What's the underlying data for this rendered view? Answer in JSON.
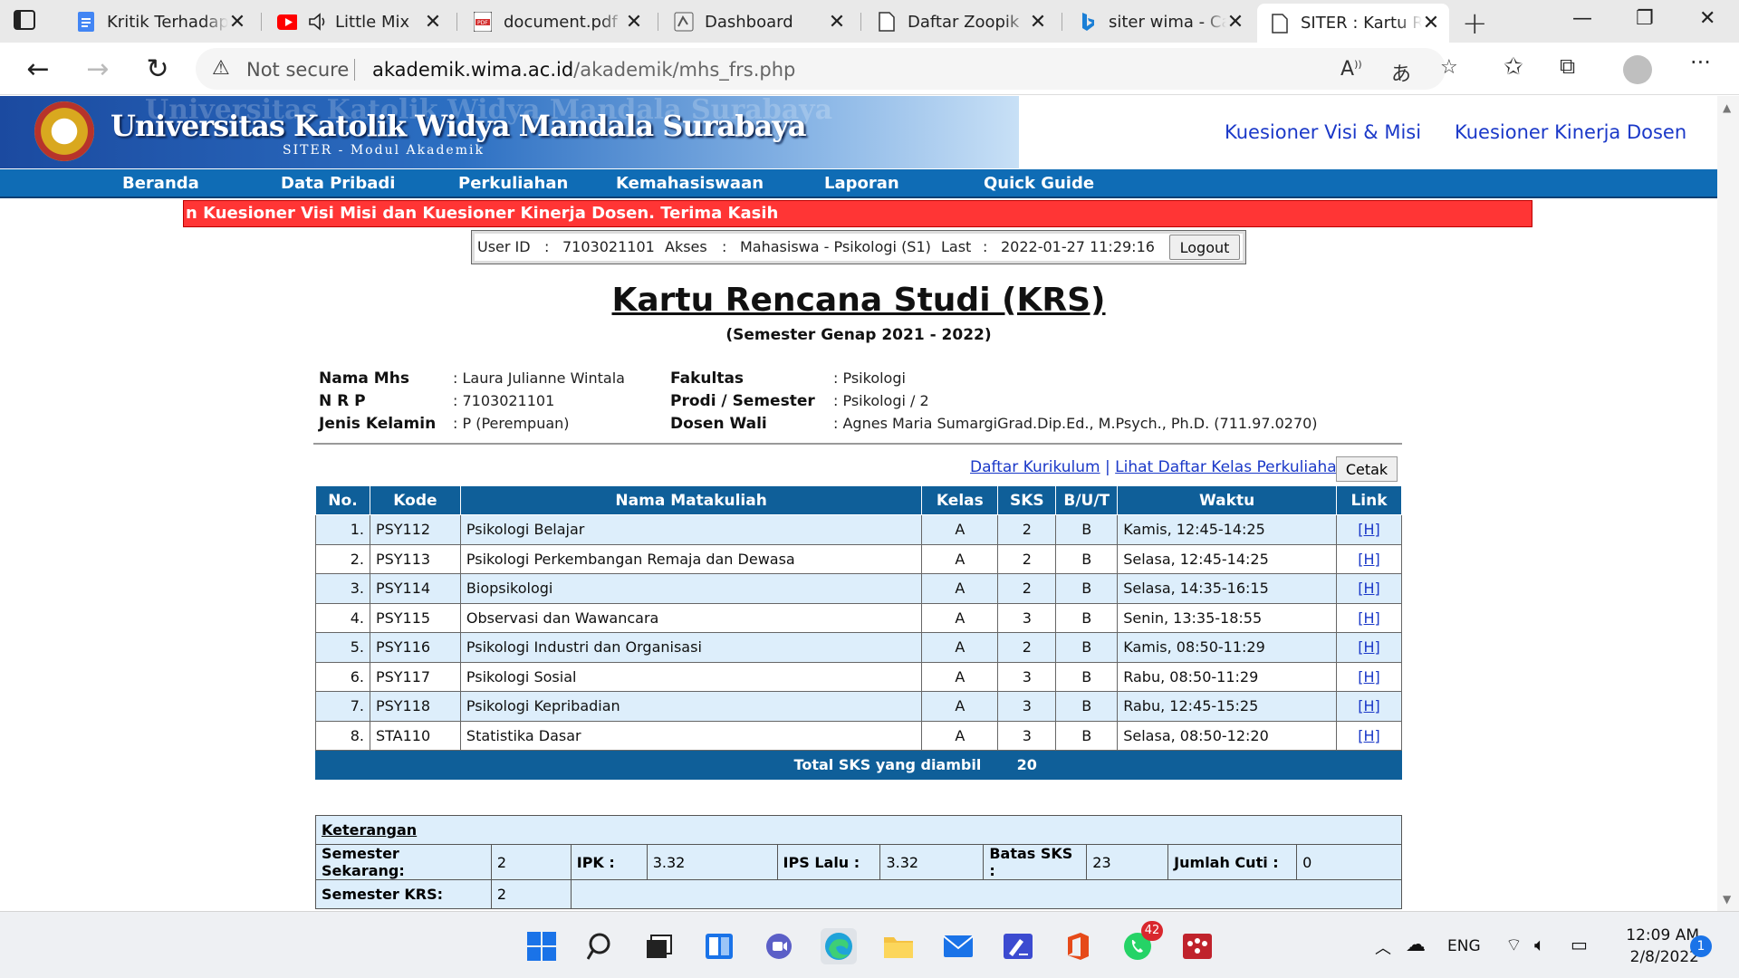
{
  "browser": {
    "tabs": [
      {
        "title": "Kritik Terhadap",
        "icon": "docs-icon"
      },
      {
        "title": "Little Mix",
        "icon": "youtube-icon"
      },
      {
        "title": "document.pdf",
        "icon": "pdf-icon"
      },
      {
        "title": "Dashboard",
        "icon": "dashboard-icon"
      },
      {
        "title": "Daftar Zoopik",
        "icon": "page-icon"
      },
      {
        "title": "siter wima - Ca",
        "icon": "bing-icon"
      },
      {
        "title": "SITER : Kartu R",
        "icon": "page-icon"
      }
    ],
    "security_label": "Not secure",
    "url_domain": "akademik.wima.ac.id",
    "url_path": "/akademik/mhs_frs.php"
  },
  "header": {
    "university": "Universitas Katolik Widya Mandala Surabaya",
    "subtitle": "SITER - Modul Akademik",
    "links": [
      "Kuesioner Visi & Misi",
      "Kuesioner Kinerja Dosen"
    ]
  },
  "menu": [
    "Beranda",
    "Data Pribadi",
    "Perkuliahan",
    "Kemahasiswaan",
    "Laporan",
    "Quick Guide"
  ],
  "marquee": "n Kuesioner Visi Misi dan Kuesioner Kinerja Dosen. Terima Kasih",
  "userbar": {
    "user_label": "User ID",
    "user_id": "7103021101",
    "akses_label": "Akses",
    "akses": "Mahasiswa - Psikologi (S1)",
    "last_label": "Last",
    "last": "2022-01-27 11:29:16",
    "logout": "Logout"
  },
  "title": "Kartu Rencana Studi (KRS)",
  "semester": "(Semester Genap 2021 - 2022)",
  "student": {
    "nama_label": "Nama Mhs",
    "nama": ": Laura Julianne Wintala",
    "nrp_label": "N R P",
    "nrp": ": 7103021101",
    "jk_label": "Jenis Kelamin",
    "jk": ": P (Perempuan)",
    "fak_label": "Fakultas",
    "fak": ": Psikologi",
    "prodi_label": "Prodi / Semester",
    "prodi": ": Psikologi / 2",
    "wali_label": "Dosen Wali",
    "wali": ": Agnes Maria SumargiGrad.Dip.Ed., M.Psych., Ph.D. (711.97.0270)"
  },
  "actions": {
    "kurikulum": "Daftar Kurikulum",
    "separator": "|",
    "kelas": "Lihat Daftar Kelas Perkuliahan",
    "cetak": "Cetak"
  },
  "table": {
    "headers": [
      "No.",
      "Kode",
      "Nama Matakuliah",
      "Kelas",
      "SKS",
      "B/U/T",
      "Waktu",
      "Link"
    ],
    "rows": [
      {
        "no": "1.",
        "kode": "PSY112",
        "nama": "Psikologi Belajar",
        "kelas": "A",
        "sks": "2",
        "but": "B",
        "waktu": "Kamis, 12:45-14:25",
        "link": "[H]"
      },
      {
        "no": "2.",
        "kode": "PSY113",
        "nama": "Psikologi Perkembangan Remaja dan Dewasa",
        "kelas": "A",
        "sks": "2",
        "but": "B",
        "waktu": "Selasa, 12:45-14:25",
        "link": "[H]"
      },
      {
        "no": "3.",
        "kode": "PSY114",
        "nama": "Biopsikologi",
        "kelas": "A",
        "sks": "2",
        "but": "B",
        "waktu": "Selasa, 14:35-16:15",
        "link": "[H]"
      },
      {
        "no": "4.",
        "kode": "PSY115",
        "nama": "Observasi dan Wawancara",
        "kelas": "A",
        "sks": "3",
        "but": "B",
        "waktu": "Senin, 13:35-18:55",
        "link": "[H]"
      },
      {
        "no": "5.",
        "kode": "PSY116",
        "nama": "Psikologi Industri dan Organisasi",
        "kelas": "A",
        "sks": "2",
        "but": "B",
        "waktu": "Kamis, 08:50-11:29",
        "link": "[H]"
      },
      {
        "no": "6.",
        "kode": "PSY117",
        "nama": "Psikologi Sosial",
        "kelas": "A",
        "sks": "3",
        "but": "B",
        "waktu": "Rabu, 08:50-11:29",
        "link": "[H]"
      },
      {
        "no": "7.",
        "kode": "PSY118",
        "nama": "Psikologi Kepribadian",
        "kelas": "A",
        "sks": "3",
        "but": "B",
        "waktu": "Rabu, 12:45-15:25",
        "link": "[H]"
      },
      {
        "no": "8.",
        "kode": "STA110",
        "nama": "Statistika Dasar",
        "kelas": "A",
        "sks": "3",
        "but": "B",
        "waktu": "Selasa, 08:50-12:20",
        "link": "[H]"
      }
    ],
    "total_label": "Total SKS yang diambil",
    "total_value": "20"
  },
  "keterangan": {
    "title": "Keterangan",
    "semester_sekarang_label": "Semester Sekarang:",
    "semester_sekarang": "2",
    "ipk_label": "IPK :",
    "ipk": "3.32",
    "ips_label": "IPS Lalu :",
    "ips": "3.32",
    "batas_label": "Batas SKS :",
    "batas": "23",
    "cuti_label": "Jumlah Cuti :",
    "cuti": "0",
    "semester_krs_label": "Semester KRS:",
    "semester_krs": "2"
  },
  "taskbar": {
    "whatsapp_badge": "42",
    "language": "ENG",
    "time": "12:09 AM",
    "date": "2/8/2022",
    "notification_count": "1"
  },
  "colors": {
    "accent": "#0f5f99",
    "menu": "#0f6cb5",
    "marquee": "#ff3535",
    "row_alt": "#ddeefb",
    "link": "#1a38c8"
  }
}
